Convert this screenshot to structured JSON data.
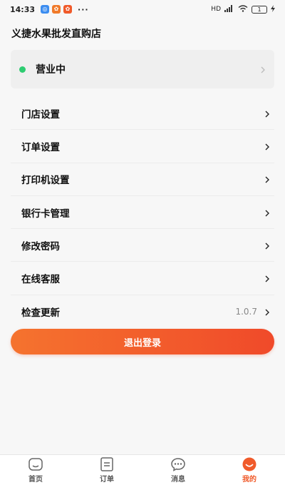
{
  "status_bar": {
    "time": "14:33",
    "more": "···",
    "network": "HD",
    "battery": "1"
  },
  "header": {
    "title": "义捷水果批发直购店"
  },
  "business_status": {
    "label": "营业中",
    "indicator_color": "#2ecc71"
  },
  "menu": {
    "items": [
      {
        "label": "门店设置"
      },
      {
        "label": "订单设置"
      },
      {
        "label": "打印机设置"
      },
      {
        "label": "银行卡管理"
      },
      {
        "label": "修改密码"
      },
      {
        "label": "在线客服"
      },
      {
        "label": "检查更新",
        "value": "1.0.7"
      }
    ]
  },
  "logout": {
    "label": "退出登录",
    "gradient": [
      "#f5732e",
      "#f04a2a"
    ]
  },
  "tabbar": {
    "tabs": [
      {
        "label": "首页",
        "icon": "home-icon"
      },
      {
        "label": "订单",
        "icon": "order-icon"
      },
      {
        "label": "消息",
        "icon": "message-icon"
      },
      {
        "label": "我的",
        "icon": "profile-icon",
        "active": true
      }
    ],
    "active_color": "#f05a2a"
  }
}
